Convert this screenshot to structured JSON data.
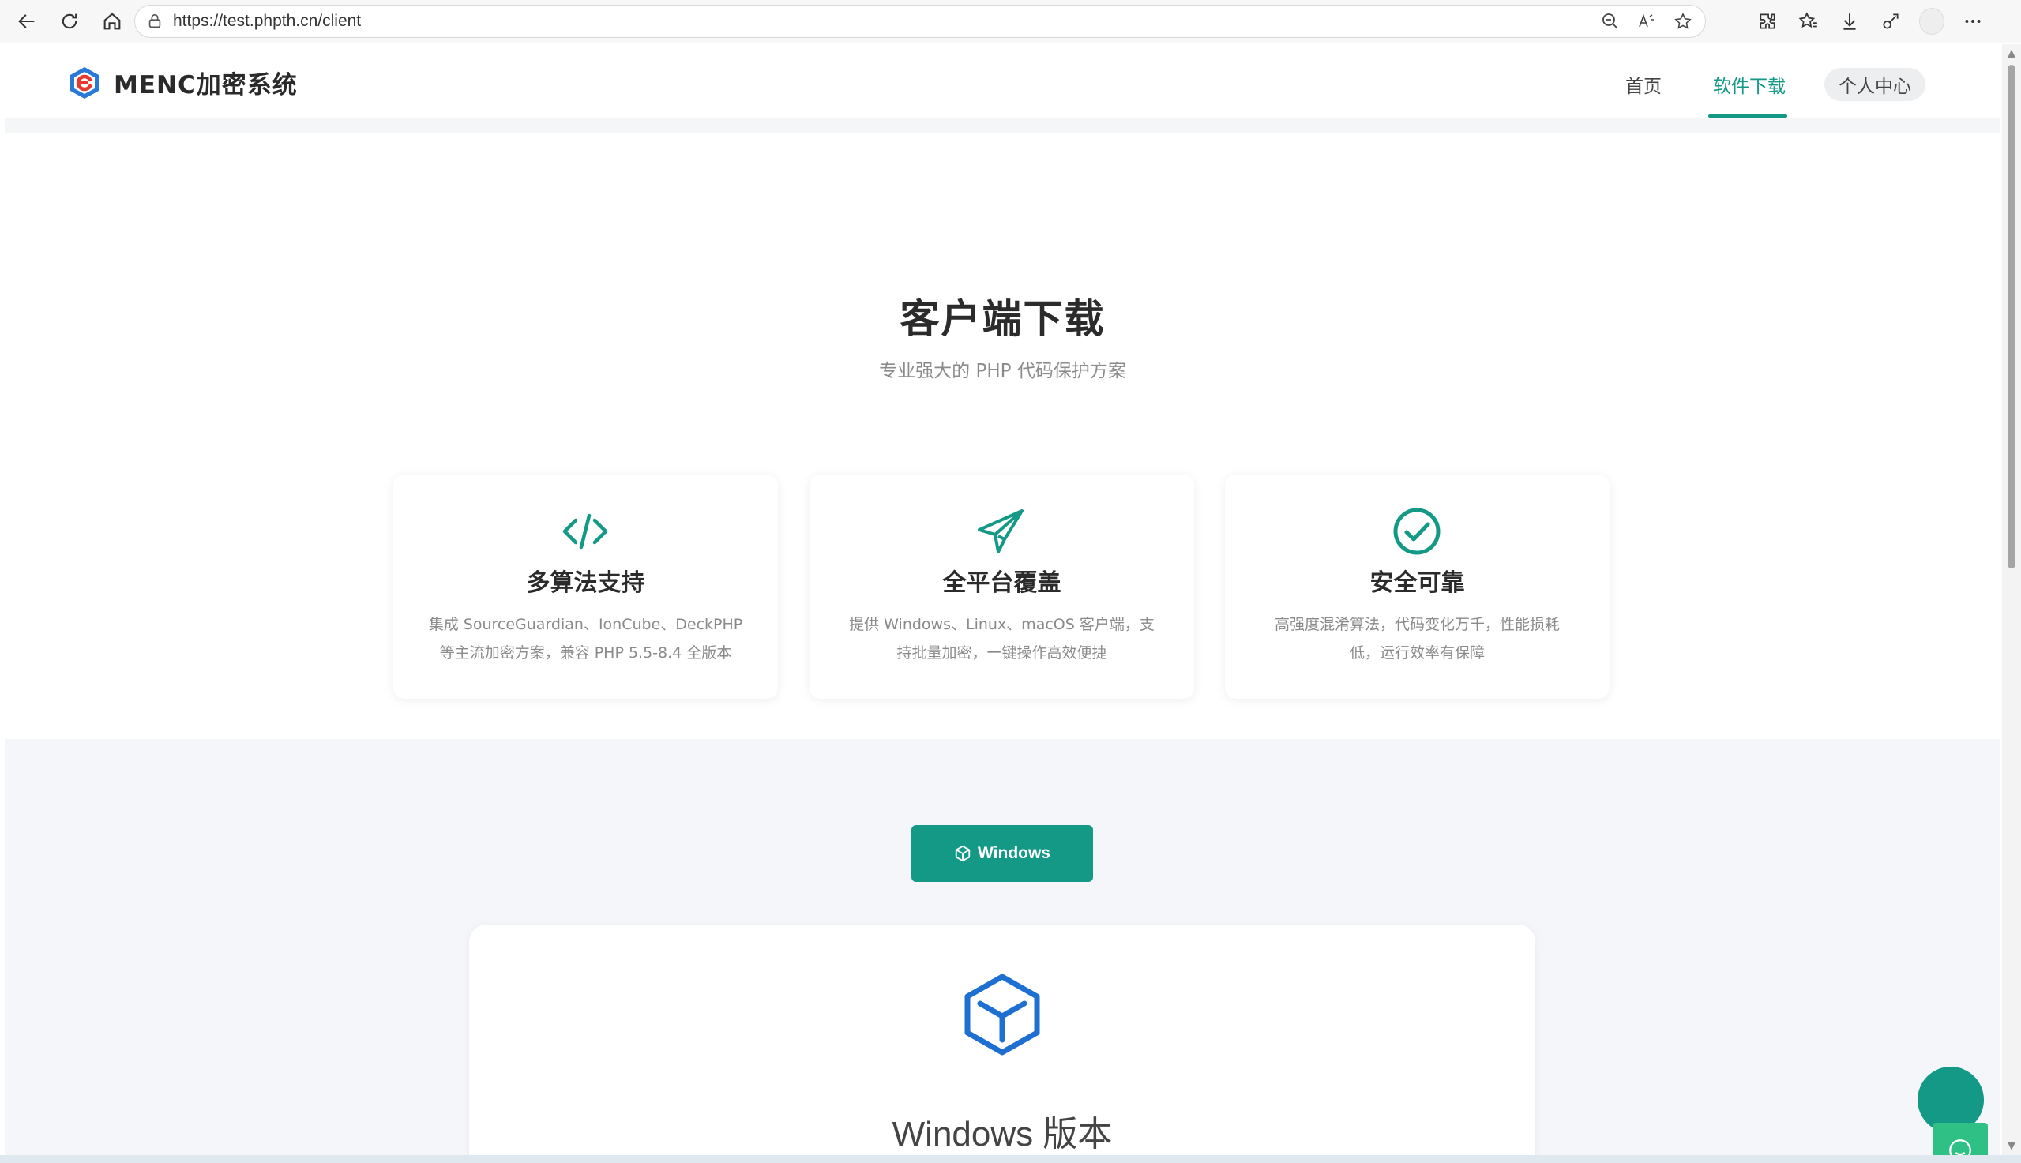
{
  "browser": {
    "url": "https://test.phpth.cn/client"
  },
  "site": {
    "brand": "MENC加密系统",
    "nav": {
      "home": "首页",
      "download": "软件下载",
      "user_center": "个人中心"
    }
  },
  "hero": {
    "title": "客户端下载",
    "subtitle": "专业强大的 PHP 代码保护方案"
  },
  "features": [
    {
      "icon": "code-icon",
      "title": "多算法支持",
      "desc_line1": "集成 SourceGuardian、IonCube、DeckPHP",
      "desc_line2": "等主流加密方案，兼容 PHP 5.5-8.4 全版本"
    },
    {
      "icon": "paper-plane-icon",
      "title": "全平台覆盖",
      "desc_line1": "提供 Windows、Linux、macOS 客户端，支",
      "desc_line2": "持批量加密，一键操作高效便捷"
    },
    {
      "icon": "check-circle-icon",
      "title": "安全可靠",
      "desc_line1": "高强度混淆算法，代码变化万千，性能损耗",
      "desc_line2": "低，运行效率有保障"
    }
  ],
  "platform_tabs": {
    "windows": "Windows"
  },
  "version_card": {
    "icon": "cube-icon",
    "title": "Windows 版本"
  },
  "colors": {
    "accent": "#139985",
    "cube": "#1d6fd1",
    "section_bg": "#f4f6f9"
  }
}
